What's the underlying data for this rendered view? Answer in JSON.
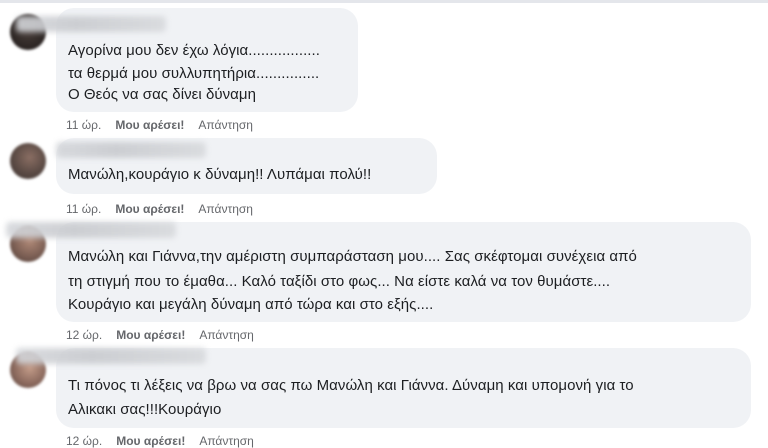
{
  "comments": [
    {
      "lines": [
        "Αγορίνα μου δεν έχω λόγια.................",
        "τα θερμά μου συλλυπητήρια...............",
        "Ο Θεός να σας δίνει δύναμη"
      ],
      "time": "11 ώρ.",
      "like_label": "Μου αρέσει!",
      "reply_label": "Απάντηση"
    },
    {
      "lines": [
        "Μανώλη,κουράγιο κ δύναμη!! Λυπάμαι πολύ!!"
      ],
      "time": "11 ώρ.",
      "like_label": "Μου αρέσει!",
      "reply_label": "Απάντηση"
    },
    {
      "lines": [
        "Μανώλη και Γιάννα,την αμέριστη συμπαράσταση μου.... Σας σκέφτομαι συνέχεια από",
        "τη στιγμή που το έμαθα... Καλό ταξίδι στο φως... Να είστε καλά να τον θυμάστε....",
        "Κουράγιο και μεγάλη δύναμη από τώρα και στο εξής...."
      ],
      "time": "12 ώρ.",
      "like_label": "Μου αρέσει!",
      "reply_label": "Απάντηση"
    },
    {
      "lines": [
        "Τι πόνος τι λέξεις να βρω να σας πω Μανώλη και Γιάννα. Δύναμη και υπομονή για το",
        "Αλικακι σας!!!Κουράγιο"
      ],
      "time": "12 ώρ.",
      "like_label": "Μου αρέσει!",
      "reply_label": "Απάντηση"
    }
  ]
}
